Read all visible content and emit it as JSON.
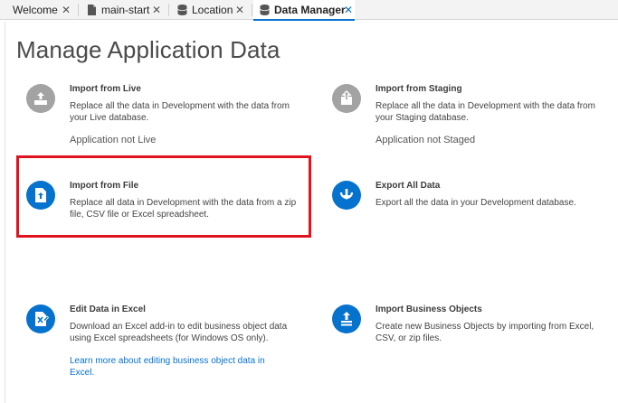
{
  "tabs": [
    {
      "label": "Welcome",
      "icon": "none",
      "close": "✕"
    },
    {
      "label": "main-start",
      "icon": "page-icon",
      "close": "✕"
    },
    {
      "label": "Location",
      "icon": "database-icon",
      "close": "✕"
    },
    {
      "label": "Data Manager",
      "icon": "database-icon",
      "close": "✕",
      "active": true
    }
  ],
  "page": {
    "title": "Manage Application Data"
  },
  "cards": {
    "import_live": {
      "title": "Import from Live",
      "desc": "Replace all the data in Development with the data from your Live database.",
      "status": "Application not Live",
      "icon": "upload-tray-icon"
    },
    "import_staging": {
      "title": "Import from Staging",
      "desc": "Replace all the data in Development with the data from your Staging database.",
      "status": "Application not Staged",
      "icon": "upload-box-icon"
    },
    "import_file": {
      "title": "Import from File",
      "desc": "Replace all data in Development with the data from a zip file, CSV file or Excel spreadsheet.",
      "icon": "file-upload-icon"
    },
    "export_all": {
      "title": "Export All Data",
      "desc": "Export all the data in your Development database.",
      "icon": "download-circle-icon"
    },
    "edit_excel": {
      "title": "Edit Data in Excel",
      "desc": "Download an Excel add-in to edit business object data using Excel spreadsheets (for Windows OS only).",
      "link": "Learn more about editing business object data in Excel.",
      "icon": "excel-edit-icon"
    },
    "import_bo": {
      "title": "Import Business Objects",
      "desc": "Create new Business Objects by importing from Excel, CSV, or zip files.",
      "icon": "import-objects-icon"
    }
  },
  "colors": {
    "accent": "#0572ce",
    "highlight": "#e0141e",
    "muted_icon": "#a3a3a3"
  }
}
